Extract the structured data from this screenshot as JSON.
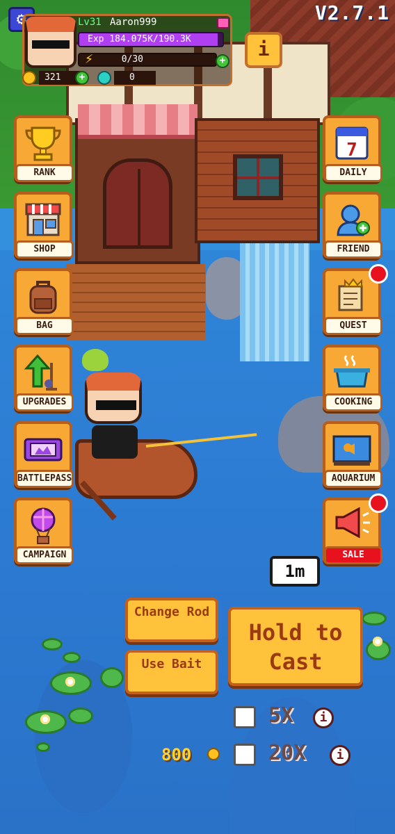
{
  "version": "V2.7.1",
  "player": {
    "level": "Lv31",
    "name": "Aaron999",
    "exp_text": "Exp  184.075K/190.3K",
    "exp_fraction": 0.967,
    "energy_text": "0/30",
    "coins": "321",
    "gems": "0"
  },
  "buttons": {
    "info": "i",
    "plus": "+"
  },
  "left_menu": [
    {
      "label": "RANK",
      "icon": "trophy-icon"
    },
    {
      "label": "SHOP",
      "icon": "shop-icon"
    },
    {
      "label": "BAG",
      "icon": "backpack-icon"
    },
    {
      "label": "UPGRADES",
      "icon": "upgrade-arrow-icon"
    },
    {
      "label": "BATTLEPASS",
      "icon": "ticket-icon"
    },
    {
      "label": "CAMPAIGN",
      "icon": "balloon-icon"
    }
  ],
  "right_menu": [
    {
      "label": "DAILY",
      "icon": "calendar-icon",
      "calendar_day": "7"
    },
    {
      "label": "FRIEND",
      "icon": "add-friend-icon"
    },
    {
      "label": "QUEST",
      "icon": "scroll-icon",
      "alert": true
    },
    {
      "label": "COOKING",
      "icon": "pot-icon"
    },
    {
      "label": "AQUARIUM",
      "icon": "fish-tank-icon"
    },
    {
      "label": "SALE",
      "icon": "megaphone-icon",
      "alert": true
    }
  ],
  "cast": {
    "distance": "1m",
    "change_rod": "Change Rod",
    "use_bait": "Use Bait",
    "hold_to_cast": "Hold to Cast"
  },
  "multipliers": [
    {
      "label": "5X",
      "price": ""
    },
    {
      "label": "20X",
      "price": "800"
    }
  ],
  "colors": {
    "button_orange": "#ffc23a",
    "alert_red": "#e8121f",
    "exp_purple": "#b13ff2"
  }
}
